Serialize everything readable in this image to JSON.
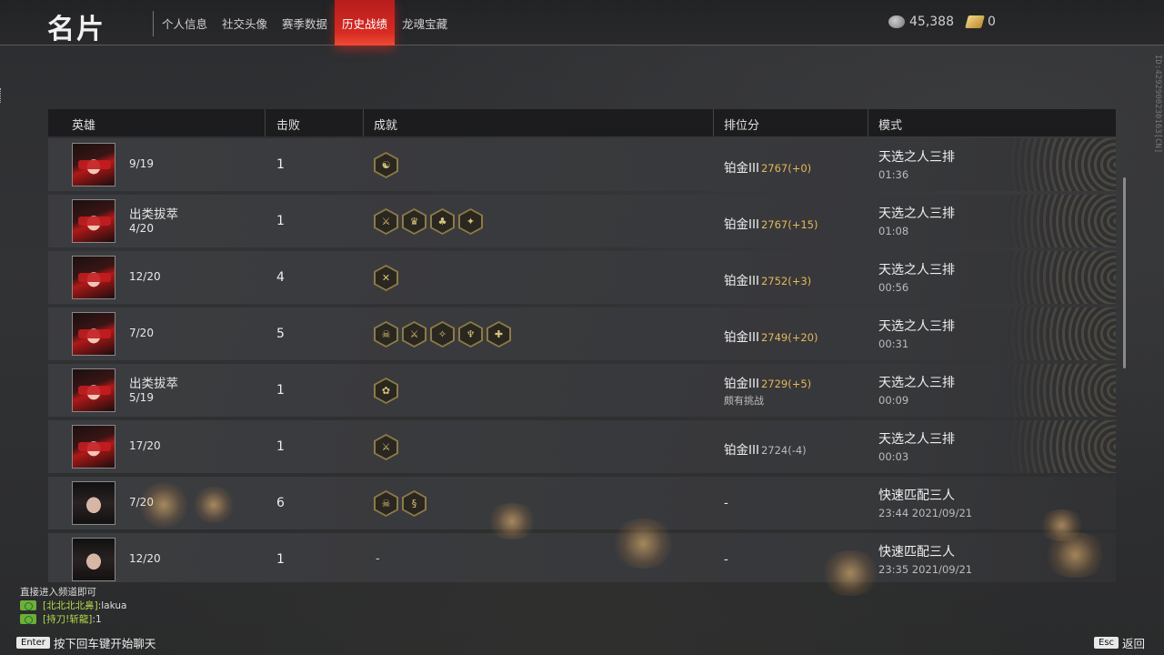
{
  "header": {
    "title": "名片",
    "tabs": [
      {
        "label": "个人信息",
        "active": false
      },
      {
        "label": "社交头像",
        "active": false
      },
      {
        "label": "赛季数据",
        "active": false
      },
      {
        "label": "历史战绩",
        "active": true
      },
      {
        "label": "龙魂宝藏",
        "active": false
      }
    ],
    "currency": [
      {
        "icon": "coin-icon",
        "value": "45,388"
      },
      {
        "icon": "gold-bar-icon",
        "value": "0"
      }
    ]
  },
  "side_id": "ID:4292900230163[CN]",
  "table": {
    "headers": {
      "hero": "英雄",
      "kills": "击败",
      "achievements": "成就",
      "rank": "排位分",
      "mode": "模式"
    },
    "rows": [
      {
        "hero_img": "hero-a",
        "title": "",
        "placement": "9/19",
        "kills": "1",
        "achievements": [
          "☯"
        ],
        "rank": "铂金III",
        "score": "2767(+0)",
        "rank_note": "",
        "mode": "天选之人三排",
        "time": "01:36"
      },
      {
        "hero_img": "hero-a",
        "title": "出类拔萃",
        "placement": "4/20",
        "kills": "1",
        "achievements": [
          "⚔",
          "♛",
          "♣",
          "✦"
        ],
        "rank": "铂金III",
        "score": "2767(+15)",
        "rank_note": "",
        "mode": "天选之人三排",
        "time": "01:08"
      },
      {
        "hero_img": "hero-a",
        "title": "",
        "placement": "12/20",
        "kills": "4",
        "achievements": [
          "✕"
        ],
        "rank": "铂金III",
        "score": "2752(+3)",
        "rank_note": "",
        "mode": "天选之人三排",
        "time": "00:56"
      },
      {
        "hero_img": "hero-a",
        "title": "",
        "placement": "7/20",
        "kills": "5",
        "achievements": [
          "☠",
          "⚔",
          "✧",
          "♆",
          "✚"
        ],
        "rank": "铂金III",
        "score": "2749(+20)",
        "rank_note": "",
        "mode": "天选之人三排",
        "time": "00:31"
      },
      {
        "hero_img": "hero-a",
        "title": "出类拔萃",
        "placement": "5/19",
        "kills": "1",
        "achievements": [
          "✿"
        ],
        "rank": "铂金III",
        "score": "2729(+5)",
        "rank_note": "颇有挑战",
        "mode": "天选之人三排",
        "time": "00:09"
      },
      {
        "hero_img": "hero-a",
        "title": "",
        "placement": "17/20",
        "kills": "1",
        "achievements": [
          "⚔"
        ],
        "rank": "铂金III",
        "score": "2724(-4)",
        "rank_note": "",
        "mode": "天选之人三排",
        "time": "00:03"
      },
      {
        "hero_img": "hero-b",
        "title": "",
        "placement": "7/20",
        "kills": "6",
        "achievements": [
          "☠",
          "§"
        ],
        "rank": "-",
        "score": "",
        "rank_note": "",
        "mode": "快速匹配三人",
        "time": "23:44  2021/09/21"
      },
      {
        "hero_img": "hero-b",
        "title": "",
        "placement": "12/20",
        "kills": "1",
        "achievements": [],
        "rank": "-",
        "score": "",
        "rank_note": "",
        "mode": "快速匹配三人",
        "time": "23:35  2021/09/21"
      }
    ],
    "no_achievement": "-"
  },
  "chat": {
    "hint": "直接进入频道即可",
    "messages": [
      {
        "name": "[北北北北鼻]",
        "text": ":lakua"
      },
      {
        "name": "[持刀!斩龍]",
        "text": ":1"
      }
    ],
    "enter_key": "Enter",
    "enter_hint": "按下回车键开始聊天",
    "esc_key": "Esc",
    "esc_hint": "返回"
  }
}
